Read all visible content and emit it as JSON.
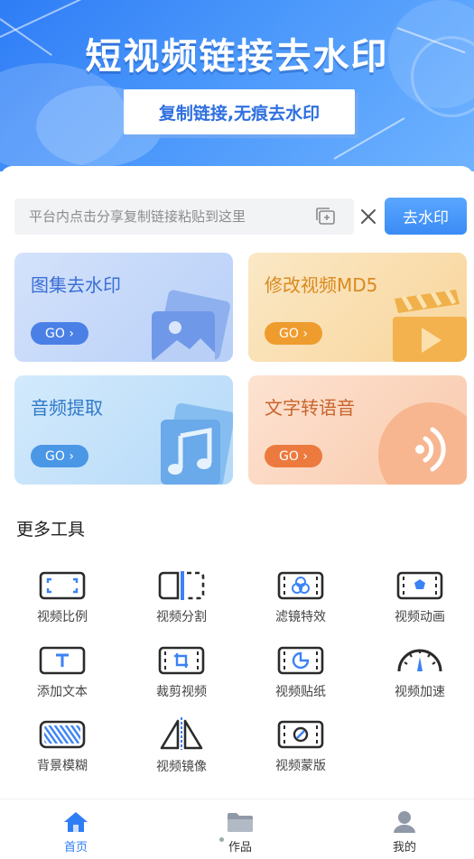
{
  "banner": {
    "title": "短视频链接去水印",
    "subtitle": "复制链接,无痕去水印"
  },
  "search": {
    "placeholder": "平台内点击分享复制链接粘贴到这里",
    "value": "",
    "submit_label": "去水印"
  },
  "cards": [
    {
      "title": "图集去水印",
      "go_label": "GO ›"
    },
    {
      "title": "修改视频MD5",
      "go_label": "GO ›"
    },
    {
      "title": "音频提取",
      "go_label": "GO ›"
    },
    {
      "title": "文字转语音",
      "go_label": "GO ›"
    }
  ],
  "more_tools": {
    "title": "更多工具",
    "items": [
      {
        "label": "视频比例",
        "icon": "aspect-ratio-icon"
      },
      {
        "label": "视频分割",
        "icon": "split-icon"
      },
      {
        "label": "滤镜特效",
        "icon": "filter-icon"
      },
      {
        "label": "视频动画",
        "icon": "animation-icon"
      },
      {
        "label": "添加文本",
        "icon": "text-icon"
      },
      {
        "label": "裁剪视频",
        "icon": "crop-icon"
      },
      {
        "label": "视频贴纸",
        "icon": "sticker-icon"
      },
      {
        "label": "视频加速",
        "icon": "speedometer-icon"
      },
      {
        "label": "背景模糊",
        "icon": "blur-icon"
      },
      {
        "label": "视频镜像",
        "icon": "mirror-icon"
      },
      {
        "label": "视频蒙版",
        "icon": "mask-icon"
      }
    ]
  },
  "tabbar": {
    "items": [
      {
        "label": "首页",
        "icon": "home-icon",
        "active": true
      },
      {
        "label": "作品",
        "icon": "folder-icon",
        "active": false
      },
      {
        "label": "我的",
        "icon": "user-icon",
        "active": false
      }
    ]
  },
  "colors": {
    "accent": "#2f7df6",
    "icon_stroke": "#2b2b2b",
    "icon_accent": "#3b82f6"
  }
}
